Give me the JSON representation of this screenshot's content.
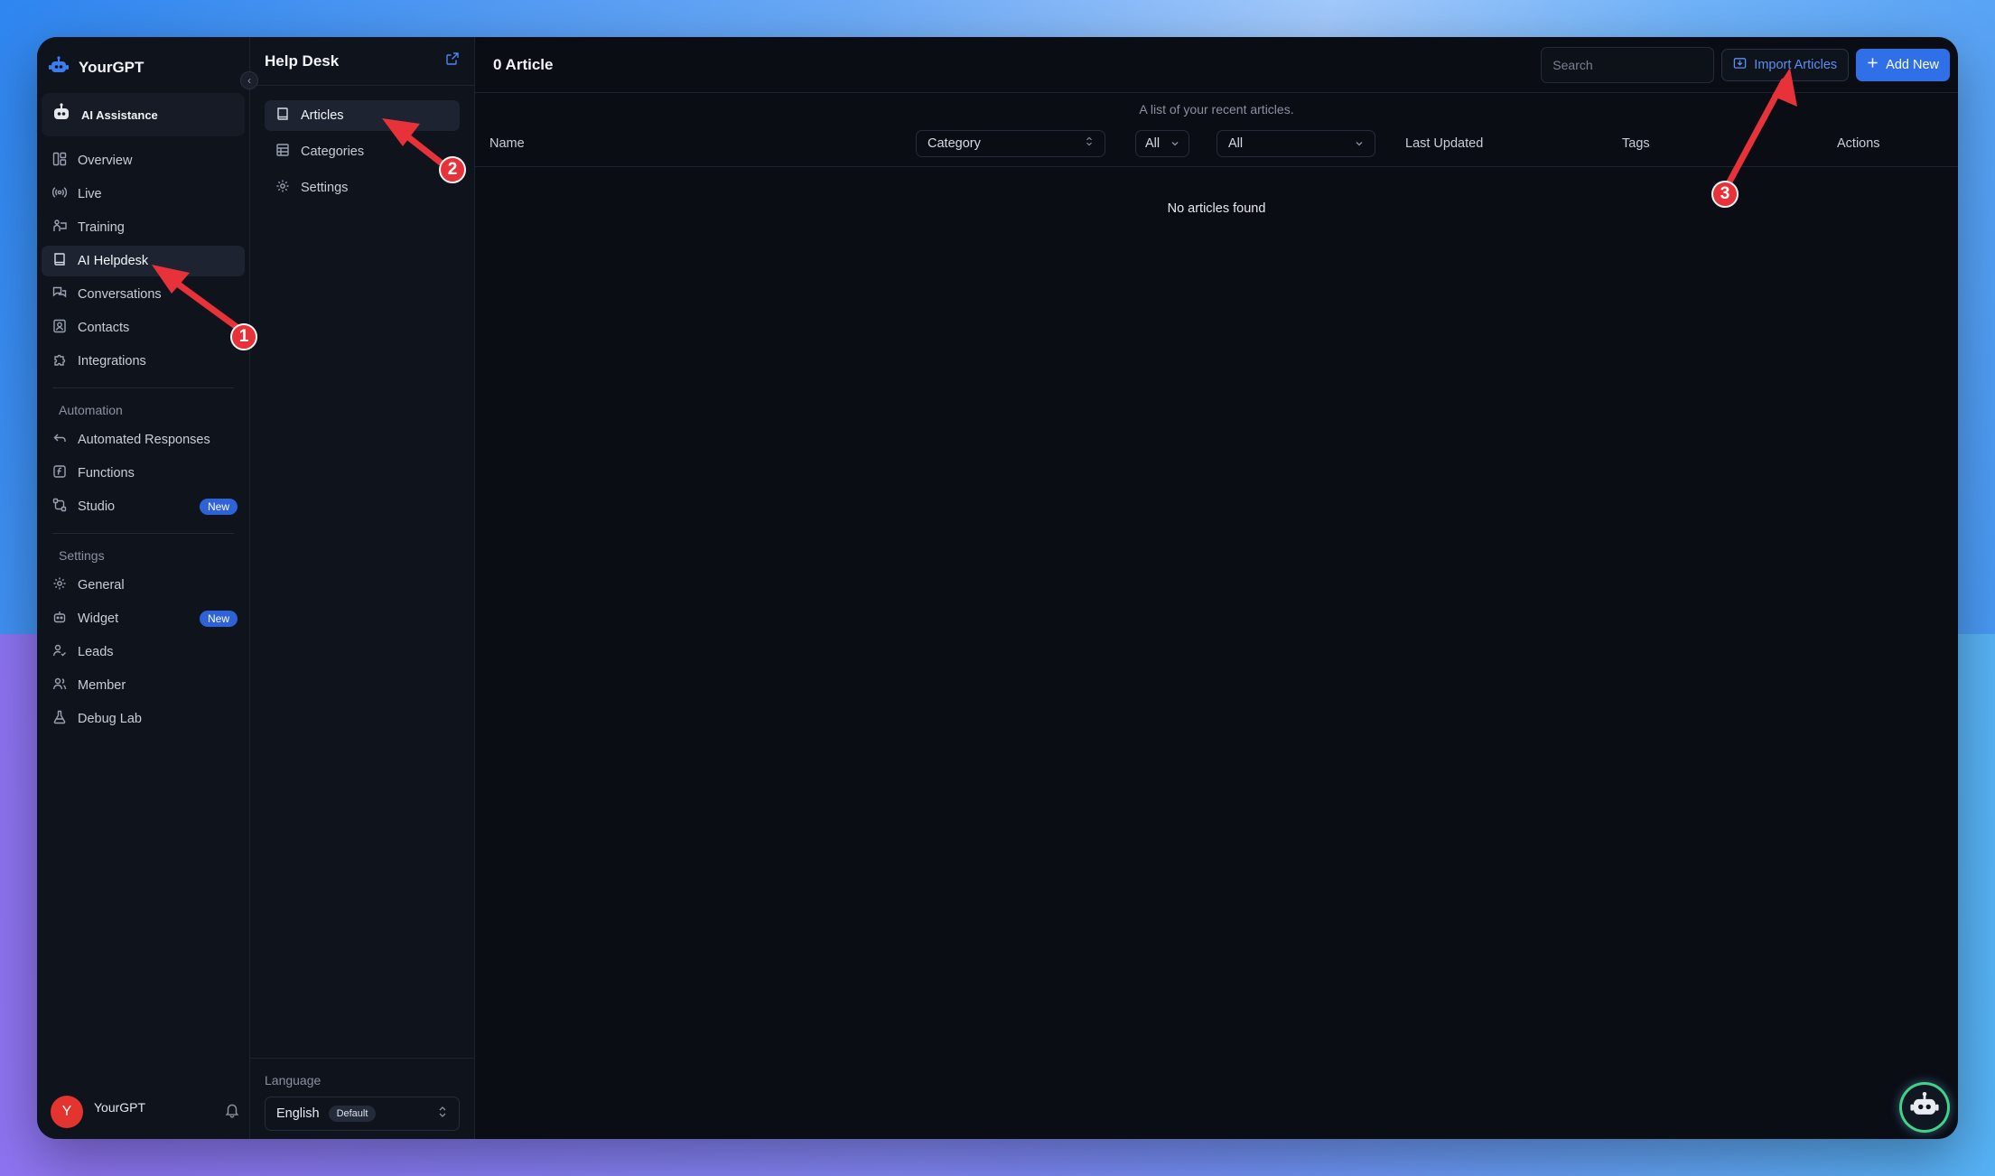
{
  "brand": {
    "name": "YourGPT"
  },
  "assistant": {
    "label": "AI Assistance"
  },
  "sidebar": {
    "items": [
      {
        "label": "Overview",
        "icon": "layout-icon"
      },
      {
        "label": "Live",
        "icon": "broadcast-icon"
      },
      {
        "label": "Training",
        "icon": "training-icon"
      },
      {
        "label": "AI Helpdesk",
        "icon": "book-icon",
        "active": true
      },
      {
        "label": "Conversations",
        "icon": "chat-icon"
      },
      {
        "label": "Contacts",
        "icon": "contact-icon"
      },
      {
        "label": "Integrations",
        "icon": "puzzle-icon"
      }
    ],
    "automation": {
      "title": "Automation",
      "items": [
        {
          "label": "Automated Responses",
          "icon": "reply-icon"
        },
        {
          "label": "Functions",
          "icon": "function-icon"
        },
        {
          "label": "Studio",
          "icon": "workflow-icon",
          "badge": "New"
        }
      ]
    },
    "settings": {
      "title": "Settings",
      "items": [
        {
          "label": "General",
          "icon": "gear-icon"
        },
        {
          "label": "Widget",
          "icon": "bot-icon",
          "badge": "New"
        },
        {
          "label": "Leads",
          "icon": "user-check-icon"
        },
        {
          "label": "Member",
          "icon": "users-icon"
        },
        {
          "label": "Debug Lab",
          "icon": "flask-icon"
        }
      ]
    },
    "user": {
      "initial": "Y",
      "name": "YourGPT"
    }
  },
  "panel": {
    "title": "Help Desk",
    "items": [
      {
        "label": "Articles",
        "icon": "book-icon",
        "active": true
      },
      {
        "label": "Categories",
        "icon": "table-icon"
      },
      {
        "label": "Settings",
        "icon": "gear-icon"
      }
    ],
    "language": {
      "label": "Language",
      "value": "English",
      "tag": "Default"
    }
  },
  "main": {
    "title": "0 Article",
    "search_placeholder": "Search",
    "import_label": "Import Articles",
    "add_label": "Add New",
    "caption": "A list of your recent articles.",
    "columns": {
      "name": "Name",
      "category": "Category",
      "filter1": "All",
      "filter2": "All",
      "last_updated": "Last Updated",
      "tags": "Tags",
      "actions": "Actions"
    },
    "empty": "No articles found"
  },
  "annotations": [
    "1",
    "2",
    "3"
  ],
  "colors": {
    "accent": "#2f6fe7",
    "marker": "#e8323a",
    "background": "#0a0d14"
  }
}
